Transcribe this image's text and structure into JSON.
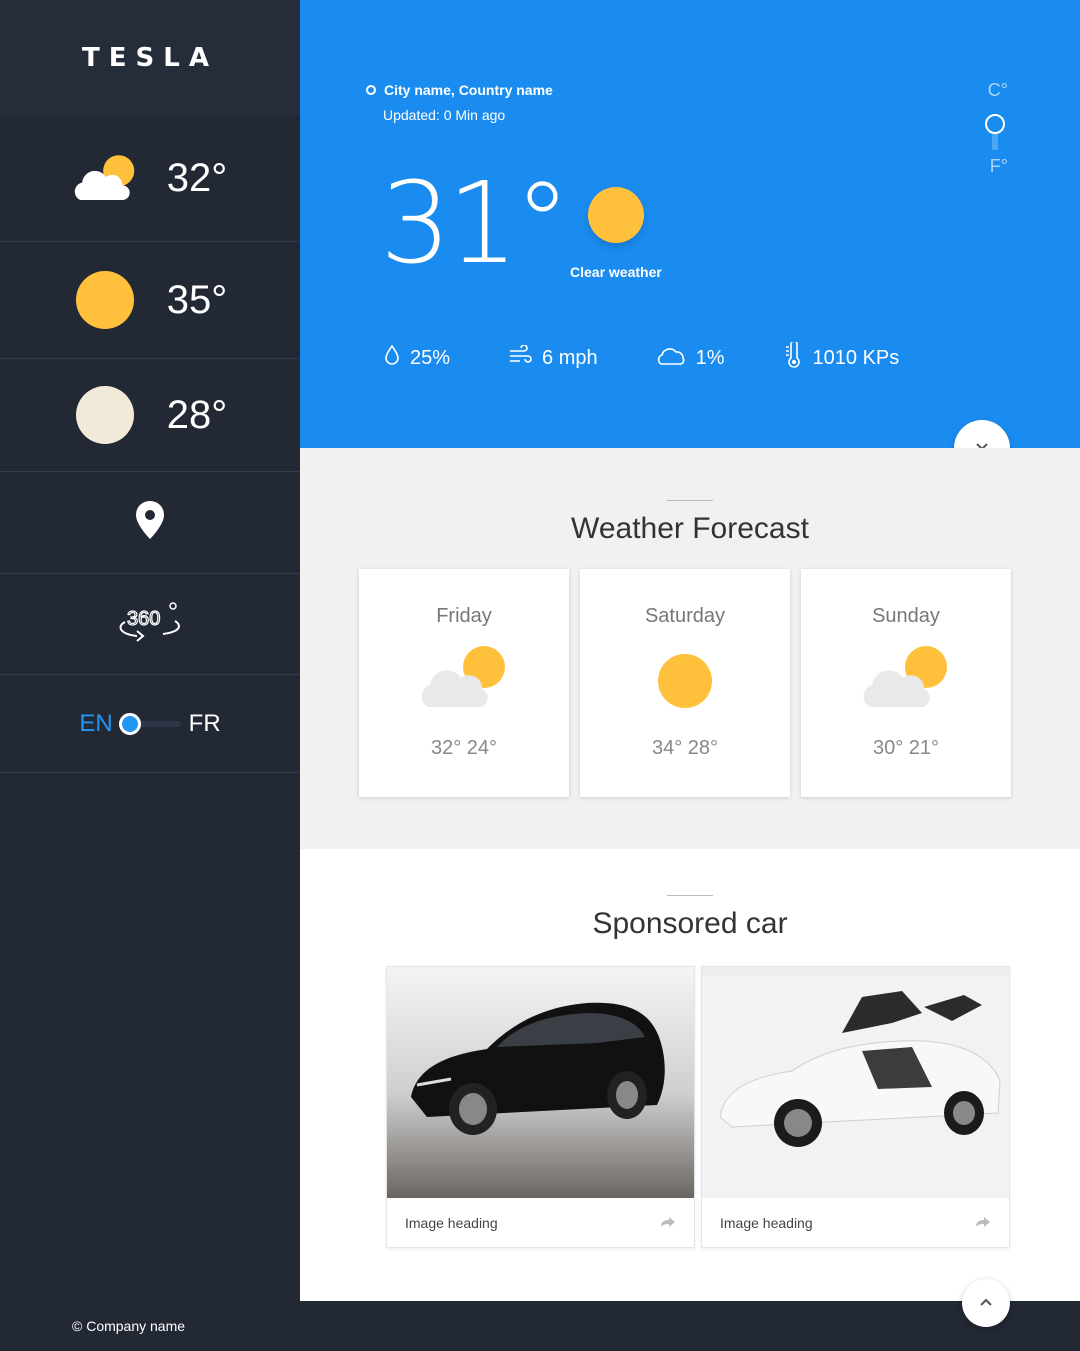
{
  "brand": {
    "logo": "TESLA"
  },
  "sidebar": {
    "temps": [
      {
        "icon": "cloud-sun-icon",
        "value": "32°"
      },
      {
        "icon": "sun-icon",
        "value": "35°"
      },
      {
        "icon": "moon-icon",
        "value": "28°"
      }
    ],
    "location_icon": "map-pin-icon",
    "view_icon": "360-view-icon",
    "language": {
      "en": "EN",
      "fr": "FR",
      "selected": "EN"
    }
  },
  "current": {
    "location": "City name, Country name",
    "updated": "Updated: 0 Min ago",
    "temperature": "31°",
    "condition": "Clear weather",
    "unit_c": "C°",
    "unit_f": "F°",
    "stats": {
      "humidity": "25%",
      "wind": "6 mph",
      "clouds": "1%",
      "pressure": "1010 KPs"
    }
  },
  "forecast": {
    "title": "Weather Forecast",
    "days": [
      {
        "day": "Friday",
        "icon": "cloud-sun-icon",
        "temps": "32° 24°"
      },
      {
        "day": "Saturday",
        "icon": "sun-icon",
        "temps": "34° 28°"
      },
      {
        "day": "Sunday",
        "icon": "cloud-sun-icon",
        "temps": "30° 21°"
      }
    ]
  },
  "sponsored": {
    "title": "Sponsored car",
    "cars": [
      {
        "heading": "Image heading"
      },
      {
        "heading": "Image heading"
      }
    ]
  },
  "footer": {
    "text": "© Company name"
  },
  "colors": {
    "accent": "#1a8cf0",
    "sidebar": "#222834",
    "sun": "#ffc13c",
    "moon": "#f1ead9"
  }
}
